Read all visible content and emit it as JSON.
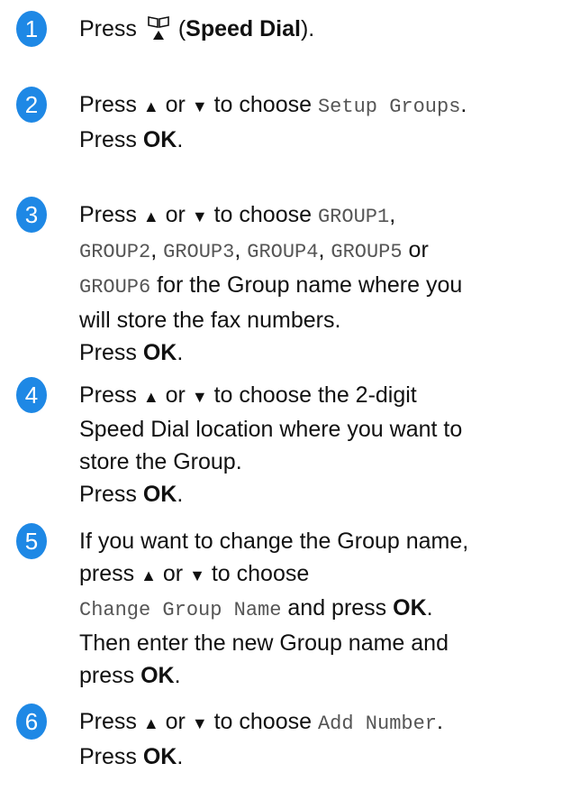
{
  "accent_color": "#1e88e5",
  "steps": [
    {
      "number": "1",
      "press": "Press",
      "open_paren": "(",
      "speed_dial": "Speed Dial",
      "close": ")."
    },
    {
      "number": "2",
      "press": "Press",
      "up": "▲",
      "or": "or",
      "down": "▼",
      "to_choose": "to choose",
      "option": "Setup Groups",
      "period": ".",
      "press2": "Press",
      "ok": "OK",
      "period2": "."
    },
    {
      "number": "3",
      "press": "Press",
      "up": "▲",
      "or": "or",
      "down": "▼",
      "to_choose": "to choose",
      "g1": "GROUP1",
      "g2": "GROUP2",
      "g3": "GROUP3",
      "g4": "GROUP4",
      "g5": "GROUP5",
      "comma": ",",
      "or2": "or",
      "g6": "GROUP6",
      "rest1": "for the Group name where you",
      "rest2": "will store the fax numbers.",
      "press2": "Press",
      "ok": "OK",
      "period2": "."
    },
    {
      "number": "4",
      "press": "Press",
      "up": "▲",
      "or": "or",
      "down": "▼",
      "rest1": "to choose the 2-digit",
      "rest2": "Speed Dial location where you want to",
      "rest3": "store the Group.",
      "press2": "Press",
      "ok": "OK",
      "period2": "."
    },
    {
      "number": "5",
      "line1": "If you want to change the Group name,",
      "press": "press",
      "up": "▲",
      "or": "or",
      "down": "▼",
      "to_choose": "to choose",
      "option": "Change Group Name",
      "and_press": "and press",
      "ok": "OK",
      "period": ".",
      "line4": "Then enter the new Group name and",
      "press2": "press",
      "ok2": "OK",
      "period2": "."
    },
    {
      "number": "6",
      "press": "Press",
      "up": "▲",
      "or": "or",
      "down": "▼",
      "to_choose": "to choose",
      "option": "Add Number",
      "period": ".",
      "press2": "Press",
      "ok": "OK",
      "period2": "."
    }
  ]
}
